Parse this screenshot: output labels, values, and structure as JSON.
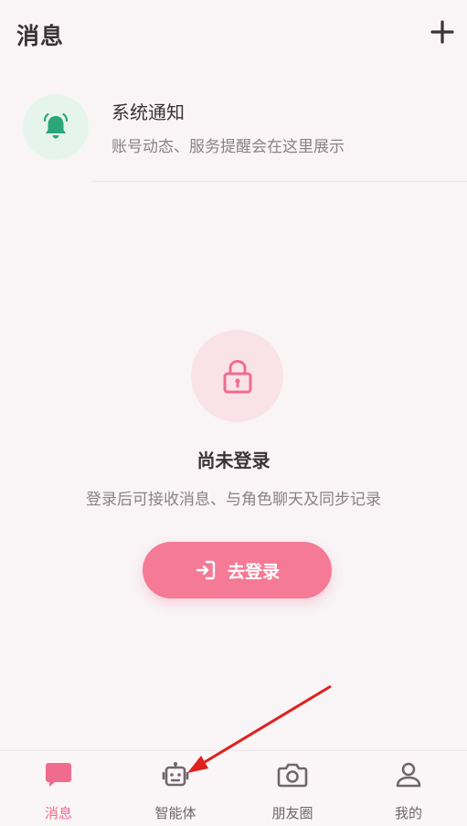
{
  "header": {
    "title": "消息",
    "add_icon": "plus-icon"
  },
  "notice": {
    "icon": "bell-icon",
    "title": "系统通知",
    "subtitle": "账号动态、服务提醒会在这里展示"
  },
  "empty_state": {
    "icon": "lock-icon",
    "title": "尚未登录",
    "description": "登录后可接收消息、与角色聊天及同步记录",
    "button_label": "去登录",
    "button_icon": "login-icon"
  },
  "tabs": [
    {
      "label": "消息",
      "icon": "chat-bubble-icon",
      "active": true
    },
    {
      "label": "智能体",
      "icon": "robot-icon",
      "active": false
    },
    {
      "label": "朋友圈",
      "icon": "camera-icon",
      "active": false
    },
    {
      "label": "我的",
      "icon": "user-icon",
      "active": false
    }
  ],
  "colors": {
    "accent": "#f47a96",
    "active_tab": "#f06c8e",
    "bell": "#2aa67a",
    "annotation_arrow": "#e0201c"
  }
}
